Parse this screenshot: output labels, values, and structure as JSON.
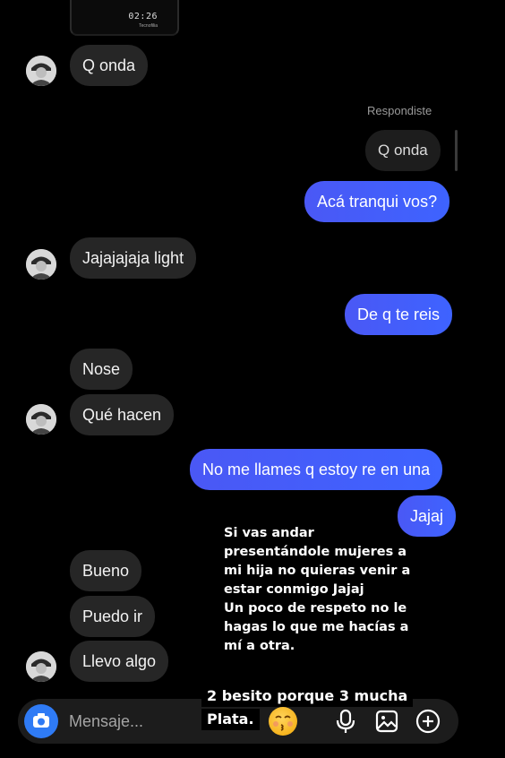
{
  "media_preview": {
    "time": "02:26",
    "subtitle": "Tecnofilia"
  },
  "messages": {
    "m1": "Q onda",
    "reply_label": "Respondiste",
    "reply_quote": "Q onda",
    "m2": "Acá tranqui vos?",
    "m3": "Jajajajaja light",
    "m4": "De q te reis",
    "m5": "Nose",
    "m6": "Qué hacen",
    "m7": "No me llames q estoy re en una",
    "m8": "Jajaj",
    "m9": "Bueno",
    "m10": "Puedo ir",
    "m11": "Llevo algo"
  },
  "overlay": {
    "paragraph": "Si vas andar\npresentándole mujeres a\nmi hija no quieras venir a\nestar conmigo Jajaj\nUn poco de respeto no le\nhagas lo que me hacías a\nmí a otra.",
    "caption_line1": "2 besito porque 3 mucha",
    "caption_line2": "Plata.",
    "emoji": "kissing-face-emoji"
  },
  "composer": {
    "placeholder": "Mensaje..."
  },
  "colors": {
    "background": "#000000",
    "incoming": "#262626",
    "outgoing": "#3e63ff",
    "camera": "#2f7bf5"
  }
}
